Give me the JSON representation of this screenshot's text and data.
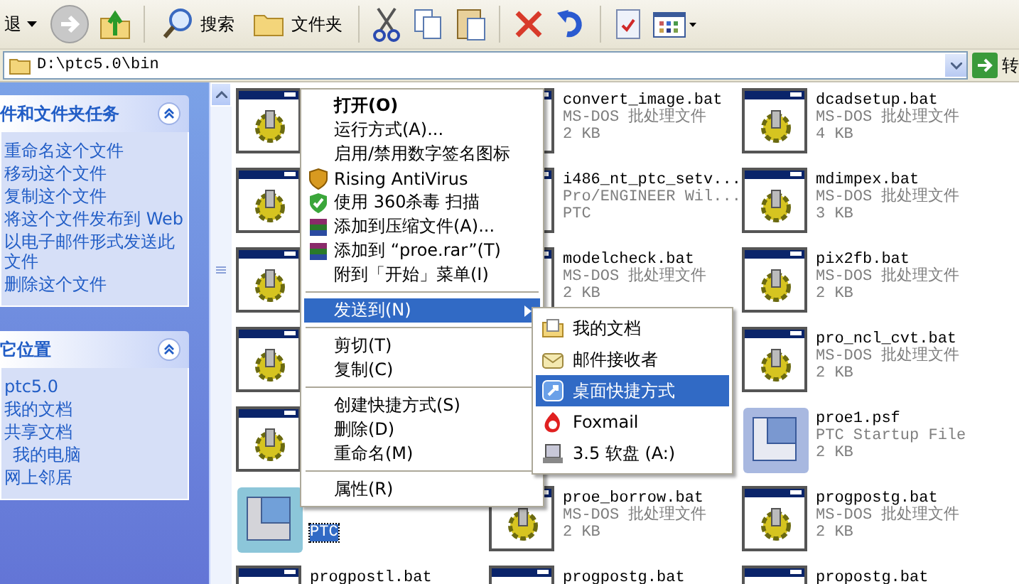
{
  "toolbar": {
    "back_label": "退",
    "buttons": [
      {
        "label": "搜索"
      },
      {
        "label": "文件夹"
      }
    ]
  },
  "address": {
    "value": "D:\\ptc5.0\\bin",
    "go_label": "转"
  },
  "panels": [
    {
      "title": "件和文件夹任务",
      "expanded": true,
      "items": [
        "重命名这个文件",
        "移动这个文件",
        "复制这个文件",
        "将这个文件发布到 Web",
        "以电子邮件形式发送此文件",
        "删除这个文件"
      ]
    },
    {
      "title": "它位置",
      "expanded": true,
      "items": [
        "ptc5.0",
        "我的文档",
        "共享文档",
        "我的电脑",
        "网上邻居"
      ]
    }
  ],
  "files": [
    {
      "kind": "bat",
      "selected": false
    },
    {
      "kind": "bat",
      "selected": false,
      "name": "convert_image.bat",
      "type": "MS-DOS 批处理文件",
      "info": "2 KB"
    },
    {
      "kind": "bat",
      "selected": false,
      "name": "dcadsetup.bat",
      "type": "MS-DOS 批处理文件",
      "info": "4 KB"
    },
    {
      "kind": "bat",
      "selected": false
    },
    {
      "kind": "bat",
      "selected": false,
      "name": "i486_nt_ptc_setv...",
      "type": "Pro/ENGINEER Wil...",
      "info": "PTC"
    },
    {
      "kind": "bat",
      "selected": false,
      "name": "mdimpex.bat",
      "type": "MS-DOS 批处理文件",
      "info": "3 KB"
    },
    {
      "kind": "bat",
      "selected": false
    },
    {
      "kind": "bat",
      "selected": false,
      "name": "modelcheck.bat",
      "type": "MS-DOS 批处理文件",
      "info": "2 KB"
    },
    {
      "kind": "bat",
      "selected": false,
      "name": "pix2fb.bat",
      "type": "MS-DOS 批处理文件",
      "info": "2 KB"
    },
    {
      "kind": "bat",
      "selected": false
    },
    {
      "kind": "bat"
    },
    {
      "kind": "bat",
      "selected": false,
      "name": "pro_ncl_cvt.bat",
      "type": "MS-DOS 批处理文件",
      "info": "2 KB"
    },
    {
      "kind": "bat",
      "selected": false
    },
    {
      "kind": "bat"
    },
    {
      "kind": "psf",
      "selected": false,
      "name": "proe1.psf",
      "type": "PTC Startup File",
      "info": "2 KB"
    },
    {
      "kind": "psf",
      "selected": true,
      "info": "PTC"
    },
    {
      "kind": "bat",
      "selected": false,
      "name": "proe_borrow.bat",
      "type": "MS-DOS 批处理文件",
      "info": "2 KB"
    },
    {
      "kind": "bat",
      "selected": false,
      "name": "progpostg.bat",
      "type": "MS-DOS 批处理文件",
      "info": "2 KB"
    },
    {
      "kind": "bat",
      "selected": false,
      "name": "progpostl.bat"
    },
    {
      "kind": "bat",
      "selected": false,
      "name": "progpostg.bat"
    },
    {
      "kind": "bat",
      "selected": false,
      "name": "propostg.bat"
    }
  ],
  "context_menu": {
    "items": [
      {
        "kind": "item",
        "label": "打开(O)",
        "bold": true,
        "selected": false,
        "submenu": false
      },
      {
        "kind": "item",
        "label": "运行方式(A)...",
        "bold": false,
        "selected": false,
        "submenu": false
      },
      {
        "kind": "item",
        "label": "启用/禁用数字签名图标",
        "bold": false,
        "selected": false,
        "submenu": false
      },
      {
        "kind": "item",
        "label": "Rising AntiVirus",
        "bold": false,
        "selected": false,
        "submenu": false
      },
      {
        "kind": "item",
        "label": "使用 360杀毒 扫描",
        "bold": false,
        "selected": false,
        "submenu": false
      },
      {
        "kind": "item",
        "label": "添加到压缩文件(A)...",
        "bold": false,
        "selected": false,
        "submenu": false
      },
      {
        "kind": "item",
        "label": "添加到 “proe.rar”(T)",
        "bold": false,
        "selected": false,
        "submenu": false
      },
      {
        "kind": "item",
        "label": "附到「开始」菜单(I)",
        "bold": false,
        "selected": false,
        "submenu": false
      },
      {
        "kind": "separator"
      },
      {
        "kind": "item",
        "label": "发送到(N)",
        "bold": false,
        "selected": true,
        "submenu": true
      },
      {
        "kind": "separator"
      },
      {
        "kind": "item",
        "label": "剪切(T)",
        "bold": false,
        "selected": false,
        "submenu": false
      },
      {
        "kind": "item",
        "label": "复制(C)",
        "bold": false,
        "selected": false,
        "submenu": false
      },
      {
        "kind": "separator"
      },
      {
        "kind": "item",
        "label": "创建快捷方式(S)",
        "bold": false,
        "selected": false,
        "submenu": false
      },
      {
        "kind": "item",
        "label": "删除(D)",
        "bold": false,
        "selected": false,
        "submenu": false
      },
      {
        "kind": "item",
        "label": "重命名(M)",
        "bold": false,
        "selected": false,
        "submenu": false
      },
      {
        "kind": "separator"
      },
      {
        "kind": "item",
        "label": "属性(R)",
        "bold": false,
        "selected": false,
        "submenu": false
      }
    ]
  },
  "send_to_menu": {
    "items": [
      {
        "label": "我的文档",
        "selected": false
      },
      {
        "label": "邮件接收者",
        "selected": false
      },
      {
        "label": "桌面快捷方式",
        "selected": true
      },
      {
        "label": "Foxmail",
        "selected": false
      },
      {
        "label": "3.5 软盘 (A:)",
        "selected": false
      }
    ]
  }
}
